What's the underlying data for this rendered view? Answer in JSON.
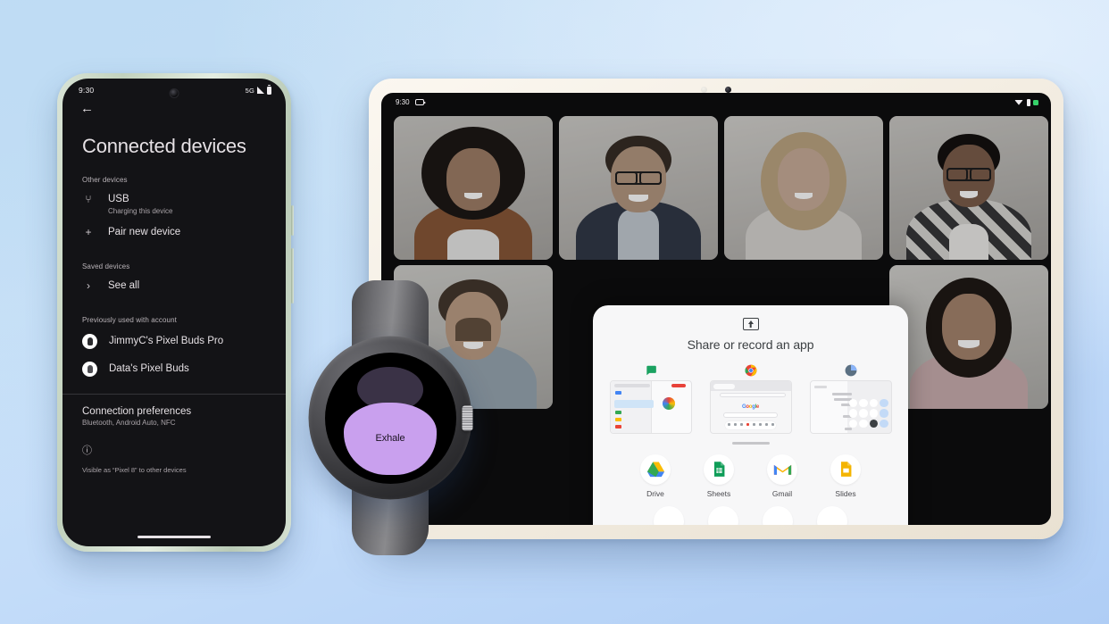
{
  "scene": {
    "background_colors": [
      "#BDDBF2",
      "#CBE2F8",
      "#AFCDF5"
    ]
  },
  "phone": {
    "device_label": "Pixel 8",
    "frame_color": "#C2D2BE",
    "status": {
      "time": "9:30",
      "network": "5G",
      "signal_icon": "signal-bars-icon",
      "battery_icon": "battery-icon"
    },
    "back_icon": "←",
    "title": "Connected devices",
    "sections": [
      {
        "header": "Other devices",
        "rows": [
          {
            "icon": "usb-icon",
            "glyph": "⑂",
            "title": "USB",
            "subtitle": "Charging this device"
          },
          {
            "icon": "plus-icon",
            "glyph": "+",
            "title": "Pair new device",
            "subtitle": ""
          }
        ]
      },
      {
        "header": "Saved devices",
        "rows": [
          {
            "icon": "chevron-right-icon",
            "glyph": "›",
            "title": "See all",
            "subtitle": ""
          }
        ]
      }
    ],
    "account_section": {
      "header": "Previously used with account",
      "devices": [
        {
          "name": "JimmyC's Pixel Buds Pro",
          "avatar": "earbuds-avatar"
        },
        {
          "name": "Data's Pixel Buds",
          "avatar": "earbuds-avatar"
        }
      ]
    },
    "preferences": {
      "title": "Connection preferences",
      "subtitle": "Bluetooth, Android Auto, NFC"
    },
    "info_icon": "info-circle-icon",
    "visibility_note": "Visible as “Pixel 8” to other devices"
  },
  "tablet": {
    "frame_color": "#F3EDE2",
    "status": {
      "time": "9:30",
      "camera_icon": "video-camera-icon",
      "wifi_icon": "wifi-icon",
      "signal_icon": "signal-icon",
      "battery_icon": "battery-icon",
      "battery_color": "#36D16A"
    },
    "call": {
      "participants": [
        {
          "id": "p1",
          "description": "woman with curly afro hair in orange blazer"
        },
        {
          "id": "p2",
          "description": "man with glasses and beard in navy blazer"
        },
        {
          "id": "p3",
          "description": "woman with long blonde hair in light top"
        },
        {
          "id": "p4",
          "description": "woman with glasses in plaid shirt"
        },
        {
          "id": "p5",
          "description": "man with beard in light blue shirt"
        },
        {
          "id": "p6",
          "description": "woman with dark wavy hair in pink sweater"
        }
      ]
    },
    "share_sheet": {
      "icon": "screen-share-icon",
      "title": "Share or record an app",
      "thumbnails": [
        {
          "app": "Messages",
          "icon": "messages-icon"
        },
        {
          "app": "Chrome",
          "icon": "chrome-icon"
        },
        {
          "app": "Calculator",
          "icon": "calculator-icon"
        }
      ],
      "drag_handle": "drag-handle",
      "apps": [
        {
          "label": "Drive",
          "icon": "drive-icon"
        },
        {
          "label": "Sheets",
          "icon": "sheets-icon"
        },
        {
          "label": "Gmail",
          "icon": "gmail-icon"
        },
        {
          "label": "Slides",
          "icon": "slides-icon"
        }
      ],
      "apps_row2": [
        {
          "label": "",
          "icon": "maps-icon"
        },
        {
          "label": "",
          "icon": "youtube-icon"
        },
        {
          "label": "",
          "icon": "calendar-icon"
        },
        {
          "label": "",
          "icon": "photos-icon"
        }
      ]
    },
    "nav_pill": "home-gesture-pill"
  },
  "watch": {
    "band_color": "#6E6E72",
    "screen": {
      "label": "Exhale",
      "light_blob_color": "#C9A0EE",
      "dark_blob_color": "#3A3246"
    },
    "crown": "side-crown-button"
  }
}
